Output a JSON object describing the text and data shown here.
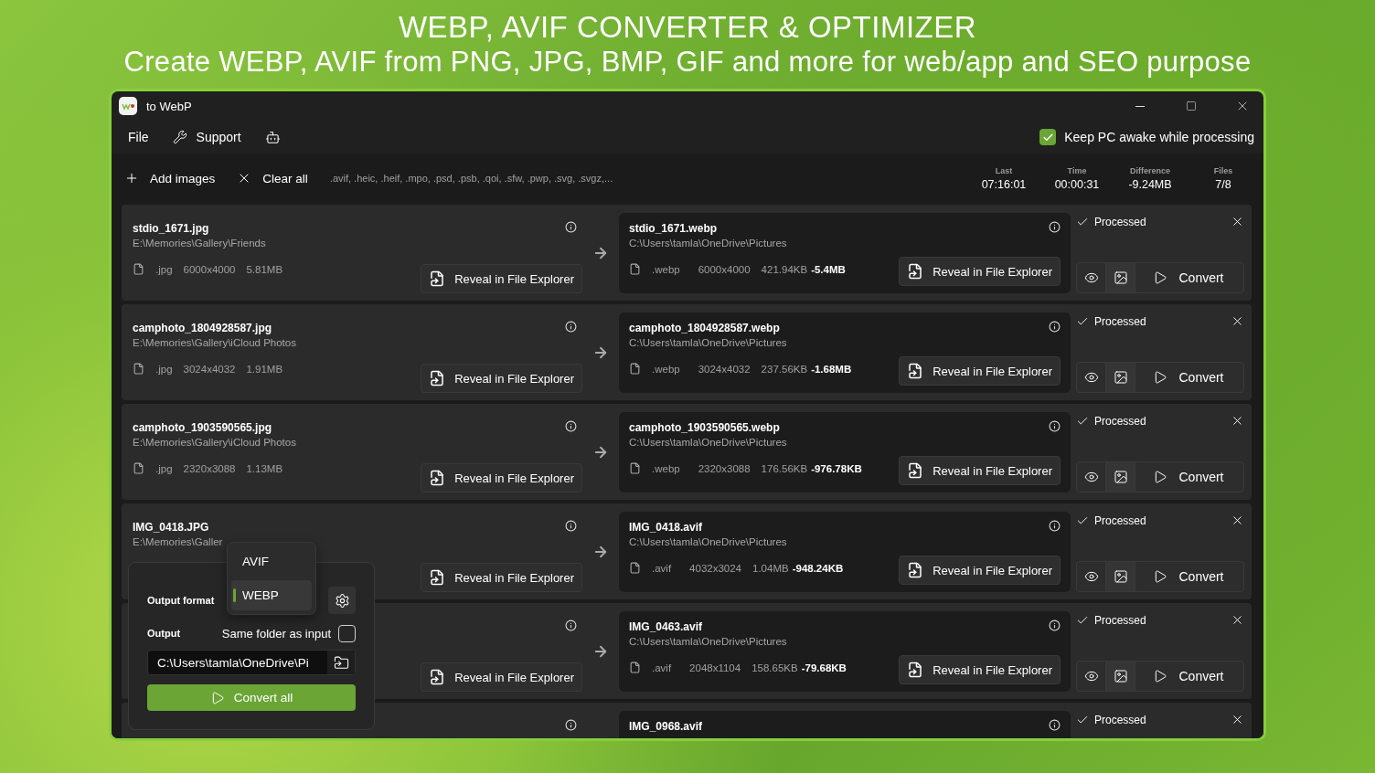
{
  "banner": {
    "title": "WEBP, AVIF CONVERTER & OPTIMIZER",
    "subtitle": "Create WEBP, AVIF from PNG, JPG, BMP, GIF and more for web/app and SEO purpose"
  },
  "window": {
    "title": "to WebP"
  },
  "menu": {
    "file": "File",
    "support": "Support",
    "keep_awake": {
      "label": "Keep PC awake while processing",
      "checked": true
    }
  },
  "toolbar": {
    "add": "Add images",
    "clear": "Clear all",
    "formats": ".avif, .heic, .heif, .mpo, .psd, .psb, .qoi, .sfw, .pwp, .svg, .svgz,..."
  },
  "stats": [
    {
      "label": "Last",
      "value": "07:16:01"
    },
    {
      "label": "Time",
      "value": "00:00:31"
    },
    {
      "label": "Difference",
      "value": "-9.24MB"
    },
    {
      "label": "Files",
      "value": "7/8"
    }
  ],
  "rows": [
    {
      "source": {
        "name": "stdio_1671.jpg",
        "path": "E:\\Memories\\Gallery\\Friends",
        "ext": ".jpg",
        "dims": "6000x4000",
        "size": "5.81MB",
        "reveal": "Reveal in File Explorer"
      },
      "output": {
        "name": "stdio_1671.webp",
        "path": "C:\\Users\\tamla\\OneDrive\\Pictures",
        "ext": ".webp",
        "dims": "6000x4000",
        "size": "421.94KB",
        "diff": "-5.4MB",
        "reveal": "Reveal in File Explorer"
      },
      "status": "Processed",
      "processed": true,
      "convert": "Convert"
    },
    {
      "source": {
        "name": "camphoto_1804928587.jpg",
        "path": "E:\\Memories\\Gallery\\iCloud Photos",
        "ext": ".jpg",
        "dims": "3024x4032",
        "size": "1.91MB",
        "reveal": "Reveal in File Explorer"
      },
      "output": {
        "name": "camphoto_1804928587.webp",
        "path": "C:\\Users\\tamla\\OneDrive\\Pictures",
        "ext": ".webp",
        "dims": "3024x4032",
        "size": "237.56KB",
        "diff": "-1.68MB",
        "reveal": "Reveal in File Explorer"
      },
      "status": "Processed",
      "processed": true,
      "convert": "Convert"
    },
    {
      "source": {
        "name": "camphoto_1903590565.jpg",
        "path": "E:\\Memories\\Gallery\\iCloud Photos",
        "ext": ".jpg",
        "dims": "2320x3088",
        "size": "1.13MB",
        "reveal": "Reveal in File Explorer"
      },
      "output": {
        "name": "camphoto_1903590565.webp",
        "path": "C:\\Users\\tamla\\OneDrive\\Pictures",
        "ext": ".webp",
        "dims": "2320x3088",
        "size": "176.56KB",
        "diff": "-976.78KB",
        "reveal": "Reveal in File Explorer"
      },
      "status": "Processed",
      "processed": true,
      "convert": "Convert"
    },
    {
      "source": {
        "name": "IMG_0418.JPG",
        "path": "E:\\Memories\\Galler",
        "reveal": "Reveal in File Explorer"
      },
      "output": {
        "name": "IMG_0418.avif",
        "path": "C:\\Users\\tamla\\OneDrive\\Pictures",
        "ext": ".avif",
        "dims": "4032x3024",
        "size": "1.04MB",
        "diff": "-948.24KB",
        "reveal": "Reveal in File Explorer"
      },
      "status": "Processed",
      "processed": true,
      "convert": "Convert"
    },
    {
      "source": {
        "reveal": "Reveal in File Explorer"
      },
      "output": {
        "name": "IMG_0463.avif",
        "path": "C:\\Users\\tamla\\OneDrive\\Pictures",
        "ext": ".avif",
        "dims": "2048x1104",
        "size": "158.65KB",
        "diff": "-79.68KB",
        "reveal": "Reveal in File Explorer"
      },
      "status": "Processed",
      "processed": true,
      "convert": "Convert"
    },
    {
      "source": {},
      "output": {
        "name": "IMG_0968.avif"
      },
      "status": "Processed",
      "processed": true
    }
  ],
  "popup": {
    "format_label": "Output format",
    "formats": [
      {
        "label": "AVIF",
        "selected": false
      },
      {
        "label": "WEBP",
        "selected": true
      }
    ],
    "output_label": "Output",
    "same_folder": {
      "label": "Same folder as input",
      "checked": false
    },
    "path": "C:\\Users\\tamla\\OneDrive\\Pi",
    "convert_all": "Convert all"
  }
}
